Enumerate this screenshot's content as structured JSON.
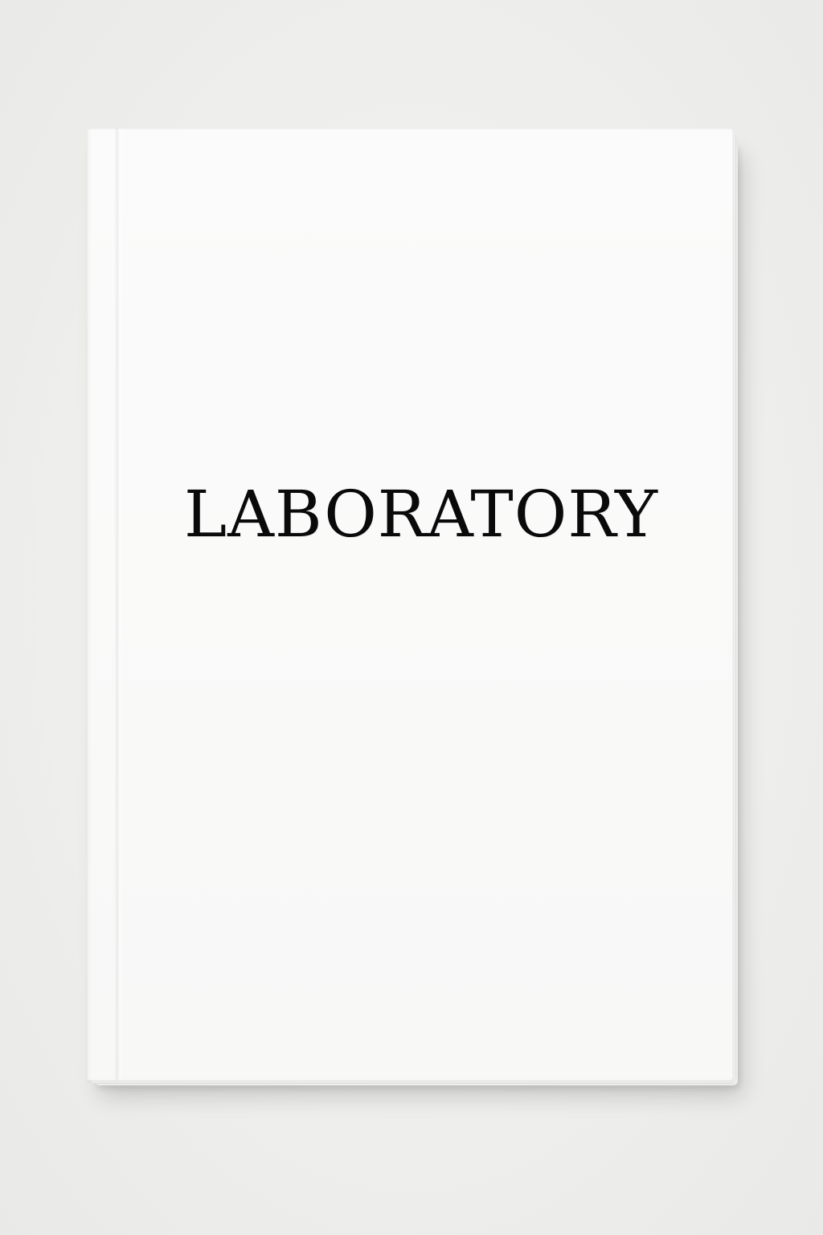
{
  "notebook": {
    "cover_title": "LABORATORY"
  },
  "colors": {
    "background": "#efefed",
    "cover": "#fafafa",
    "title_text": "#0a0a0a"
  }
}
